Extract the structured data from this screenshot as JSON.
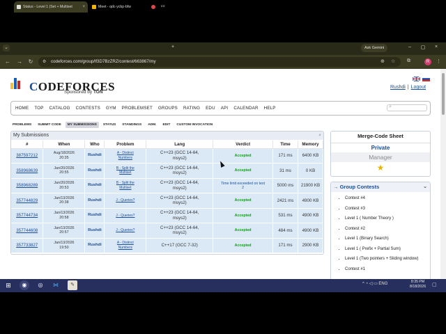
{
  "browser": {
    "tabs": [
      {
        "title": "Status - Level 1 (Set + Multiset",
        "active": true
      },
      {
        "title": "Meet - qdc-ycbp-bfw",
        "active": false
      },
      {
        "title": "",
        "active": false
      }
    ],
    "gemini_label": "Ask Gemini",
    "url": "codeforces.com/group/lf3D7BzZRZ/contest/663867/my",
    "profile_initial": "R"
  },
  "site": {
    "logo_text": "CODEFORCES",
    "sponsored_prefix": "Sponsored by",
    "sponsor": "TON",
    "user": "Rushdi",
    "logout": "Logout",
    "main_menu": [
      "HOME",
      "TOP",
      "CATALOG",
      "CONTESTS",
      "GYM",
      "PROBLEMSET",
      "GROUPS",
      "RATING",
      "EDU",
      "API",
      "CALENDAR",
      "HELP"
    ],
    "sub_menu": [
      "PROBLEMS",
      "SUBMIT CODE",
      "MY SUBMISSIONS",
      "STATUS",
      "STANDINGS",
      "ADM.",
      "EDIT",
      "CUSTOM INVOCATION"
    ],
    "sub_menu_active": "MY SUBMISSIONS"
  },
  "submissions": {
    "title": "My Submissions",
    "columns": [
      "#",
      "When",
      "Who",
      "Problem",
      "Lang",
      "Verdict",
      "Time",
      "Memory"
    ],
    "rows": [
      {
        "id": "387597212",
        "when": [
          "Aug/18/2026",
          "20:35"
        ],
        "who": "Rushdi",
        "problem": [
          "A - Distinct",
          "Numbers"
        ],
        "lang": [
          "C++23 (GCC 14-64,",
          "msys2)"
        ],
        "verdict": [
          "Accepted"
        ],
        "status": "ok",
        "time": "171 ms",
        "memory": "6400 KB"
      },
      {
        "id": "358968639",
        "when": [
          "Jan/20/2026",
          "20:55"
        ],
        "who": "Rushdi",
        "problem": [
          "B - Split the",
          "Multiset"
        ],
        "lang": [
          "C++23 (GCC 14-64,",
          "msys2)"
        ],
        "verdict": [
          "Accepted"
        ],
        "status": "ok",
        "time": "31 ms",
        "memory": "0 KB"
      },
      {
        "id": "358968289",
        "when": [
          "Jan/20/2026",
          "20:53"
        ],
        "who": "Rushdi",
        "problem": [
          "B - Split the",
          "Multiset"
        ],
        "lang": [
          "C++23 (GCC 14-64,",
          "msys2)"
        ],
        "verdict": [
          "Time limit exceeded on test",
          "2"
        ],
        "status": "tle",
        "time": "5000 ms",
        "memory": "21900 KB"
      },
      {
        "id": "357744829",
        "when": [
          "Jan/13/2026",
          "20:38"
        ],
        "who": "Rushdi",
        "problem": [
          "J - Queries?",
          ""
        ],
        "lang": [
          "C++23 (GCC 14-64,",
          "msys2)"
        ],
        "verdict": [
          "Accepted"
        ],
        "status": "ok",
        "time": "2421 ms",
        "memory": "4900 KB"
      },
      {
        "id": "357744734",
        "when": [
          "Jan/13/2026",
          "20:58"
        ],
        "who": "Rushdi",
        "problem": [
          "J - Queries?",
          ""
        ],
        "lang": [
          "C++23 (GCC 14-64,",
          "msys2)"
        ],
        "verdict": [
          "Accepted"
        ],
        "status": "ok",
        "time": "531 ms",
        "memory": "4900 KB"
      },
      {
        "id": "357744608",
        "when": [
          "Jan/13/2026",
          "20:57"
        ],
        "who": "Rushdi",
        "problem": [
          "J - Queries?",
          ""
        ],
        "lang": [
          "C++23 (GCC 14-64,",
          "msys2)"
        ],
        "verdict": [
          "Accepted"
        ],
        "status": "ok",
        "time": "484 ms",
        "memory": "4900 KB"
      },
      {
        "id": "357733827",
        "when": [
          "Jan/13/2026",
          "19:50"
        ],
        "who": "Rushdi",
        "problem": [
          "A - Distinct",
          "Numbers"
        ],
        "lang": [
          "C++17 (GCC 7-32)",
          ""
        ],
        "verdict": [
          "Accepted"
        ],
        "status": "ok",
        "time": "171 ms",
        "memory": "2900 KB"
      }
    ]
  },
  "sidebar": {
    "sheet_title": "Merge-Code Sheet",
    "visibility": "Private",
    "role": "Manager",
    "group_title": "Group Contests",
    "group_contests": [
      "Contest #4",
      "Contest #3",
      "Level 1 ( Number Theory )",
      "Contest #2",
      "Level 1 (Binary Search)",
      "Level 1 ( Prefix + Partial Sum)",
      "Level 1 (Two pointers + Sliding window)",
      "Contest #1"
    ]
  },
  "taskbar": {
    "lang": "ENG",
    "time": "8:35 PM",
    "date": "8/18/2026"
  },
  "colors": {
    "link": "#1a4d99",
    "accepted": "#00aa00",
    "row_bg": "#dbe9f7",
    "taskbar": "#262f5e"
  }
}
